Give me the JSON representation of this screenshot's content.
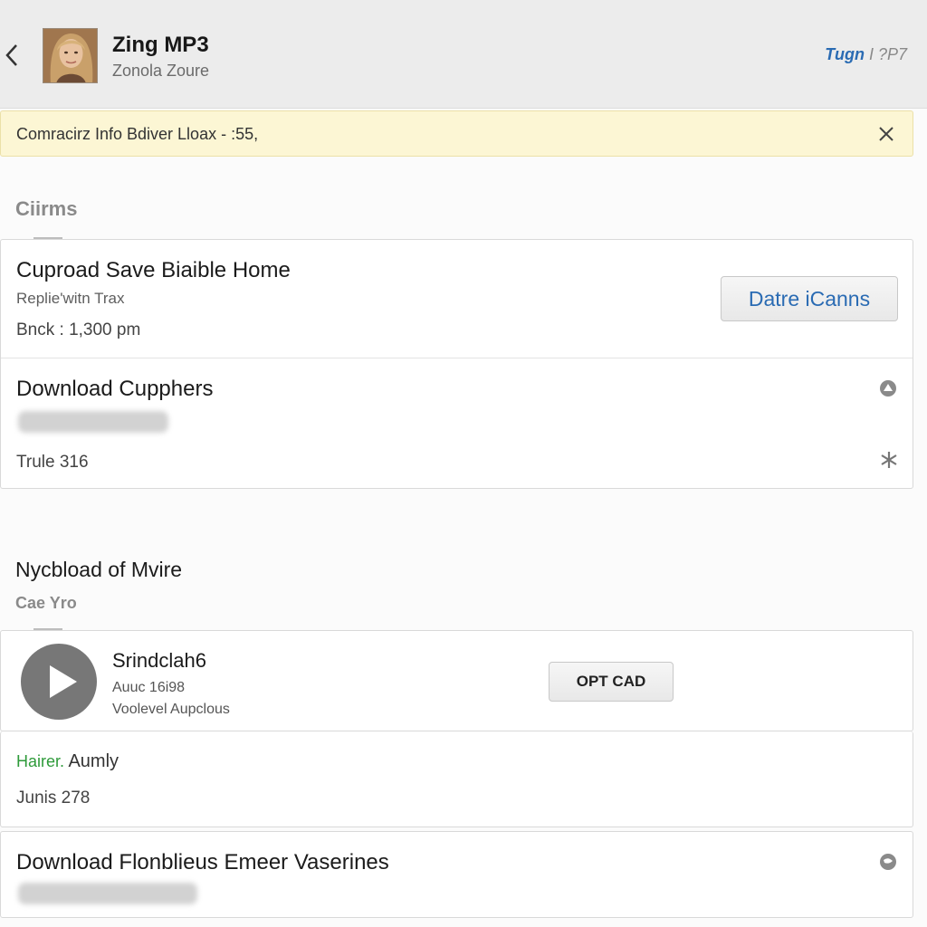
{
  "header": {
    "title": "Zing MP3",
    "subtitle": "Zonola Zoure",
    "right_link": "Tugn",
    "right_extra": "I ?P7"
  },
  "notice": {
    "text": "Comracirz Info Bdiver Lloax - :55,"
  },
  "section1": {
    "title": "Ciirms"
  },
  "card1": {
    "item1": {
      "title": "Cuproad Save Biaible Home",
      "subtitle": "Replie'witn Trax",
      "meta": "Bnck : 1,300 pm",
      "button_label": "Datre iCanns"
    },
    "item2": {
      "title": "Download Cupphers",
      "meta": "Trule 316"
    }
  },
  "section2": {
    "title": "Nycbload of Mvire",
    "subtitle": "Cae Yro"
  },
  "card2": {
    "track": {
      "title": "Srindclah6",
      "line1": "Auuc 16i98",
      "line2": "Voolevel Aupclous",
      "button_label": "OPT CAD"
    },
    "info": {
      "label": "Hairer.",
      "value": "Aumly",
      "meta": "Junis 278"
    }
  },
  "card3": {
    "title": "Download Flonblieus Emeer Vaserines"
  },
  "colors": {
    "accent": "#2a6bb3",
    "notice_bg": "#fcf6d4",
    "green_label": "#2e9a3a",
    "header_bg": "#ececec"
  },
  "icons": [
    "back-arrow-icon",
    "close-icon",
    "upload-circle-icon",
    "asterisk-icon",
    "play-icon",
    "globe-icon"
  ]
}
